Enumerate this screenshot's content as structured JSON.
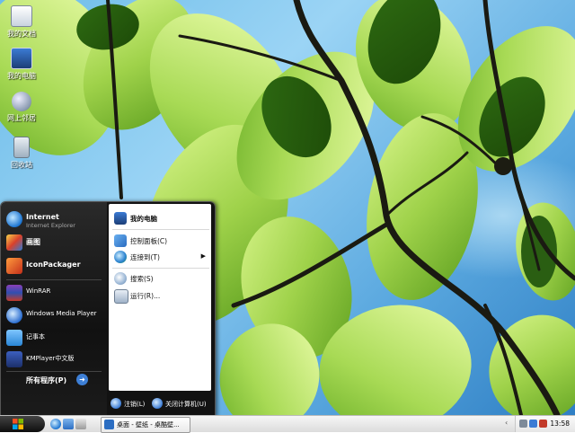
{
  "desktop": {
    "icons": [
      {
        "label": "我的文档",
        "icon": "my-documents-icon"
      },
      {
        "label": "我的电脑",
        "icon": "my-computer-icon"
      },
      {
        "label": "网上邻居",
        "icon": "network-places-icon"
      },
      {
        "label": "回收站",
        "icon": "recycle-bin-icon"
      }
    ]
  },
  "start_menu": {
    "pinned": [
      {
        "title": "Internet",
        "subtitle": "Internet Explorer",
        "icon": "internet-explorer-icon"
      },
      {
        "title": "画图",
        "icon": "paint-icon"
      },
      {
        "title": "IconPackager",
        "icon": "iconpackager-icon"
      }
    ],
    "recent": [
      {
        "title": "WinRAR",
        "icon": "winrar-icon"
      },
      {
        "title": "Windows Media Player",
        "icon": "media-player-icon"
      },
      {
        "title": "记事本",
        "icon": "notepad-icon"
      },
      {
        "title": "KMPlayer中文版",
        "icon": "kmplayer-icon"
      }
    ],
    "all_programs": "所有程序(P)",
    "right": {
      "my_computer": "我的电脑",
      "control_panel": "控制面板(C)",
      "connect_to": "连接到(T)",
      "search": "搜索(S)",
      "run": "运行(R)..."
    },
    "bottom": {
      "logoff": "注销(L)",
      "shutdown": "关闭计算机(U)"
    }
  },
  "taskbar": {
    "task_button": "桌面 - 壁纸 - 桌酷壁...",
    "clock": "13:58",
    "quick_launch": [
      "ie-icon",
      "show-desktop-icon",
      "media-icon"
    ],
    "tray_icons": [
      "volume-icon",
      "network-icon",
      "security-icon"
    ]
  }
}
